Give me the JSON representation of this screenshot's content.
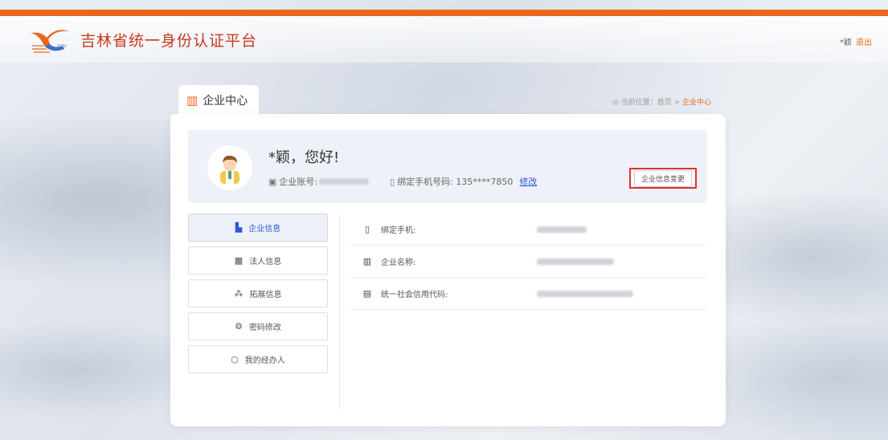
{
  "header": {
    "site_title": "吉林省统一身份认证平台",
    "user_name": "*颖",
    "logout_label": "退出"
  },
  "tab": {
    "label": "企业中心"
  },
  "breadcrumb": {
    "prefix": "◎ 当前位置：",
    "home": "首页",
    "separator": " > ",
    "current": "企业中心"
  },
  "profile": {
    "greeting": "*颖，您好!",
    "account_label": "企业账号:",
    "phone_label": "绑定手机号码: 135****7850",
    "edit_label": "修改",
    "change_button": "企业信息变更"
  },
  "menu": {
    "items": [
      {
        "label": "企业信息",
        "icon": "building-icon"
      },
      {
        "label": "法人信息",
        "icon": "id-card-icon"
      },
      {
        "label": "拓展信息",
        "icon": "share-icon"
      },
      {
        "label": "密码修改",
        "icon": "settings-icon"
      },
      {
        "label": "我的经办人",
        "icon": "circle-icon"
      }
    ]
  },
  "details": {
    "rows": [
      {
        "label": "绑定手机:",
        "icon": "phone-icon"
      },
      {
        "label": "企业名称:",
        "icon": "building-icon"
      },
      {
        "label": "统一社会信用代码:",
        "icon": "card-icon"
      }
    ]
  },
  "colors": {
    "accent": "#e8671c",
    "link": "#2a5bd7",
    "highlight": "#e0312a"
  }
}
